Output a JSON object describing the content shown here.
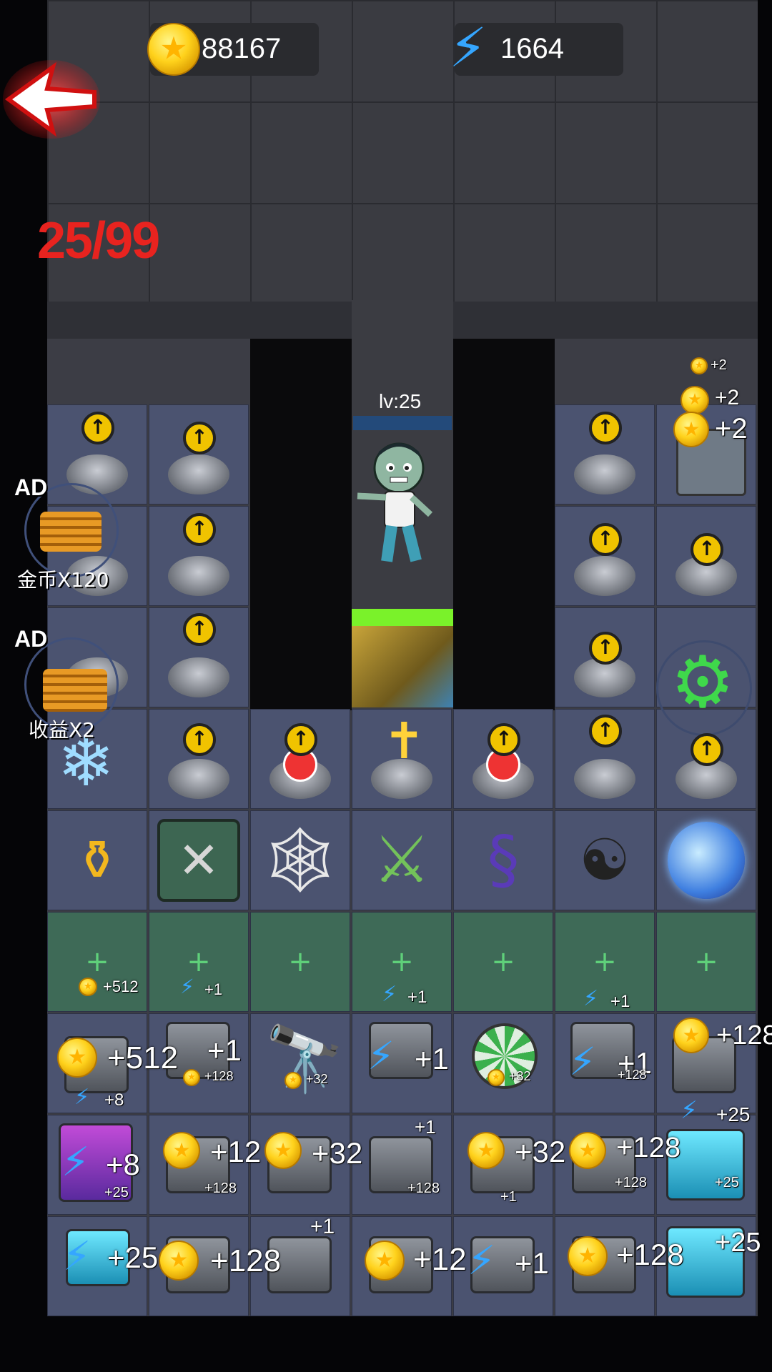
{
  "hud": {
    "coins": "88167",
    "energy": "1664",
    "wave": "25/99"
  },
  "enemy": {
    "level_label": "lv:25",
    "health_fraction": 1.0
  },
  "ads": [
    {
      "badge": "AD",
      "label": "金币X120"
    },
    {
      "badge": "AD",
      "label": "收益X2"
    }
  ],
  "floating_bonus": {
    "top_small": "+2",
    "top_mid": "+2",
    "top_big": "+2"
  },
  "empty_slot_bonuses": [
    {
      "kind": "coin",
      "text": "+512"
    },
    {
      "kind": "energy",
      "text": "+1"
    },
    {
      "kind": "energy",
      "text": "+1"
    },
    {
      "kind": "energy",
      "text": "+1"
    }
  ],
  "row1_bonuses": [
    {
      "kind": "coin",
      "text": "+512"
    },
    {
      "kind": "energy",
      "text": "+8"
    },
    {
      "kind": "energy",
      "text": "+1"
    },
    {
      "kind": "coin",
      "text": "+128"
    },
    {
      "kind": "coin",
      "text": "+32"
    },
    {
      "kind": "energy",
      "text": "+1"
    },
    {
      "kind": "coin",
      "text": "+32"
    },
    {
      "kind": "energy",
      "text": "+1"
    },
    {
      "kind": "coin",
      "text": "+128"
    },
    {
      "kind": "coin",
      "text": "+128"
    },
    {
      "kind": "energy",
      "text": "+25"
    }
  ],
  "row2_bonuses": [
    {
      "kind": "energy",
      "text": "+8"
    },
    {
      "kind": "energy",
      "text": "+25"
    },
    {
      "kind": "coin",
      "text": "+12"
    },
    {
      "kind": "coin",
      "text": "+128"
    },
    {
      "kind": "coin",
      "text": "+32"
    },
    {
      "kind": "energy",
      "text": "+1"
    },
    {
      "kind": "coin",
      "text": "+128"
    },
    {
      "kind": "coin",
      "text": "+32"
    },
    {
      "kind": "energy",
      "text": "+1"
    },
    {
      "kind": "coin",
      "text": "+128"
    },
    {
      "kind": "coin",
      "text": "+128"
    },
    {
      "kind": "energy",
      "text": "+25"
    }
  ],
  "row3_bonuses": [
    {
      "kind": "energy",
      "text": "+25"
    },
    {
      "kind": "coin",
      "text": "+128"
    },
    {
      "kind": "energy",
      "text": "+1"
    },
    {
      "kind": "coin",
      "text": "+12"
    },
    {
      "kind": "energy",
      "text": "+1"
    },
    {
      "kind": "coin",
      "text": "+128"
    },
    {
      "kind": "energy",
      "text": "+25"
    }
  ],
  "item_row": [
    "gold-pot",
    "repair-tools",
    "spider-web",
    "crossed-swords",
    "thorn-vine",
    "yin-yang-bagua",
    "lightning-orb"
  ],
  "colors": {
    "wave_red": "#e8231f",
    "health_green": "#7af22a",
    "slot_green": "#3e6a57"
  }
}
